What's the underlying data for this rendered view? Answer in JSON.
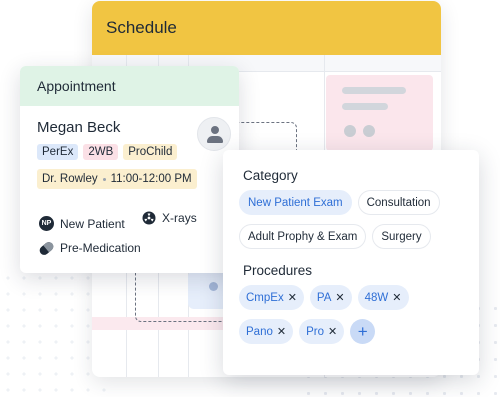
{
  "schedule": {
    "title": "Schedule"
  },
  "appointment": {
    "title": "Appointment",
    "patient_name": "Megan Beck",
    "tags": [
      "PerEx",
      "2WB",
      "ProChild"
    ],
    "doctor": "Dr. Rowley",
    "time": "11:00-12:00 PM",
    "flags": {
      "new_patient_badge": "NP",
      "new_patient": "New Patient",
      "xrays": "X-rays",
      "premed": "Pre-Medication"
    }
  },
  "category": {
    "title": "Category",
    "chips": [
      "New Patient Exam",
      "Consultation",
      "Adult Prophy & Exam",
      "Surgery"
    ],
    "selected": "New Patient Exam"
  },
  "procedures": {
    "title": "Procedures",
    "items": [
      "CmpEx",
      "PA",
      "48W",
      "Pano",
      "Pro"
    ],
    "remove_glyph": "✕",
    "add_glyph": "+"
  },
  "colors": {
    "schedule_header": "#f1c542",
    "appointment_header": "#dff3e6",
    "accent_blue": "#2f6fd6"
  }
}
